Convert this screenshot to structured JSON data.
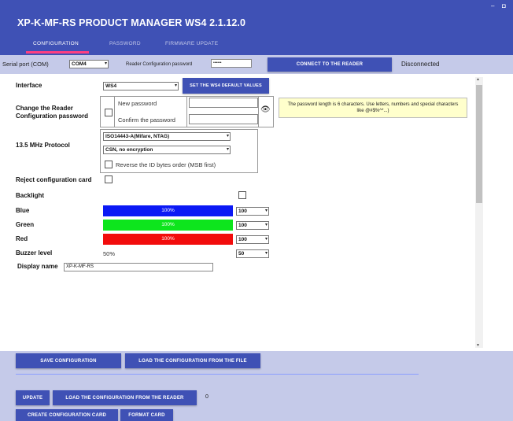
{
  "window": {
    "title": "XP-K-MF-RS  PRODUCT MANAGER WS4 2.1.12.0",
    "minimize_glyph": "–",
    "maximize_glyph": "◘"
  },
  "tabs": [
    {
      "label": "CONFIGURATION",
      "active": true
    },
    {
      "label": "PASSWORD",
      "active": false
    },
    {
      "label": "FIRMWARE UPDATE",
      "active": false
    }
  ],
  "connection": {
    "serial_port_label": "Serial port (COM)",
    "serial_port_value": "COM4",
    "reader_password_label": "Reader Configuration password",
    "reader_password_value": "••••••",
    "connect_button": "CONNECT TO THE READER",
    "status": "Disconnected"
  },
  "form": {
    "interface_label": "Interface",
    "interface_value": "WS4",
    "set_default_button": "SET THE WS4 DEFAULT VALUES",
    "change_password_label": "Change the Reader Configuration password",
    "change_password_checked": false,
    "new_password_label": "New password",
    "new_password_value": "",
    "confirm_password_label": "Confirm the password",
    "confirm_password_value": "",
    "password_hint": "The password length is 6 characters. Use letters, numbers and special characters like @#$%^*...)",
    "protocol_label": "13.5 MHz Protocol",
    "protocol_value": "ISO14443-A(Mifare, NTAG)",
    "encryption_value": "CSN, no encryption",
    "reverse_id_label": "Reverse the ID bytes order (MSB first)",
    "reverse_id_checked": false,
    "reject_card_label": "Reject configuration card",
    "reject_card_checked": false,
    "backlight_label": "Backlight",
    "backlight_checked": false,
    "colors": [
      {
        "name": "blue",
        "label": "Blue",
        "percent_text": "100%",
        "value": "100",
        "color": "#0b19f5"
      },
      {
        "name": "green",
        "label": "Green",
        "percent_text": "100%",
        "value": "100",
        "color": "#0de51d"
      },
      {
        "name": "red",
        "label": "Red",
        "percent_text": "100%",
        "value": "100",
        "color": "#f20c0c"
      }
    ],
    "buzzer_label": "Buzzer level",
    "buzzer_percent": "50%",
    "buzzer_value": "50",
    "display_name_label": "Display name",
    "display_name_value": "XP-K-MF-RS"
  },
  "actions": {
    "save_button": "SAVE CONFIGURATION",
    "load_file_button": "LOAD THE CONFIGURATION FROM THE FILE",
    "update_button": "UPDATE",
    "load_reader_button": "LOAD THE CONFIGURATION FROM THE READER",
    "counter": "0",
    "create_card_button": "CREATE CONFIGURATION CARD",
    "format_card_button": "FORMAT CARD"
  },
  "icons": {
    "eye": "eye-icon",
    "dropdown": "chevron-down-icon"
  },
  "theme": {
    "primary": "#3f51b5",
    "light": "#c5cae9",
    "accent": "#ff4081",
    "hint_background": "#ffffcc"
  }
}
